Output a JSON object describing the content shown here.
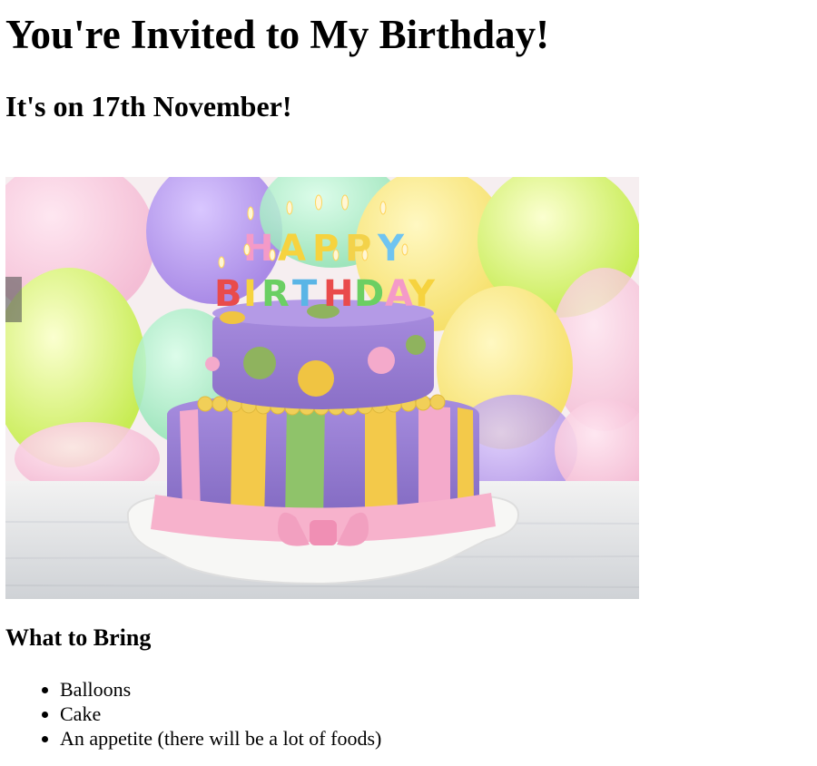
{
  "page": {
    "title": "You're Invited to My Birthday!",
    "subtitle": "It's on 17th November!"
  },
  "image": {
    "icon": "birthday-cake-photo",
    "cake_topper": "HAPPY BIRTHDAY"
  },
  "bring": {
    "heading": "What to Bring",
    "items": [
      "Balloons",
      "Cake",
      "An appetite (there will be a lot of foods)"
    ]
  },
  "colors": {
    "purple": "#9a7fd0",
    "lime": "#b8e05a",
    "yellow": "#f3c94a",
    "pink": "#f4aacb",
    "green": "#8fc36a"
  }
}
